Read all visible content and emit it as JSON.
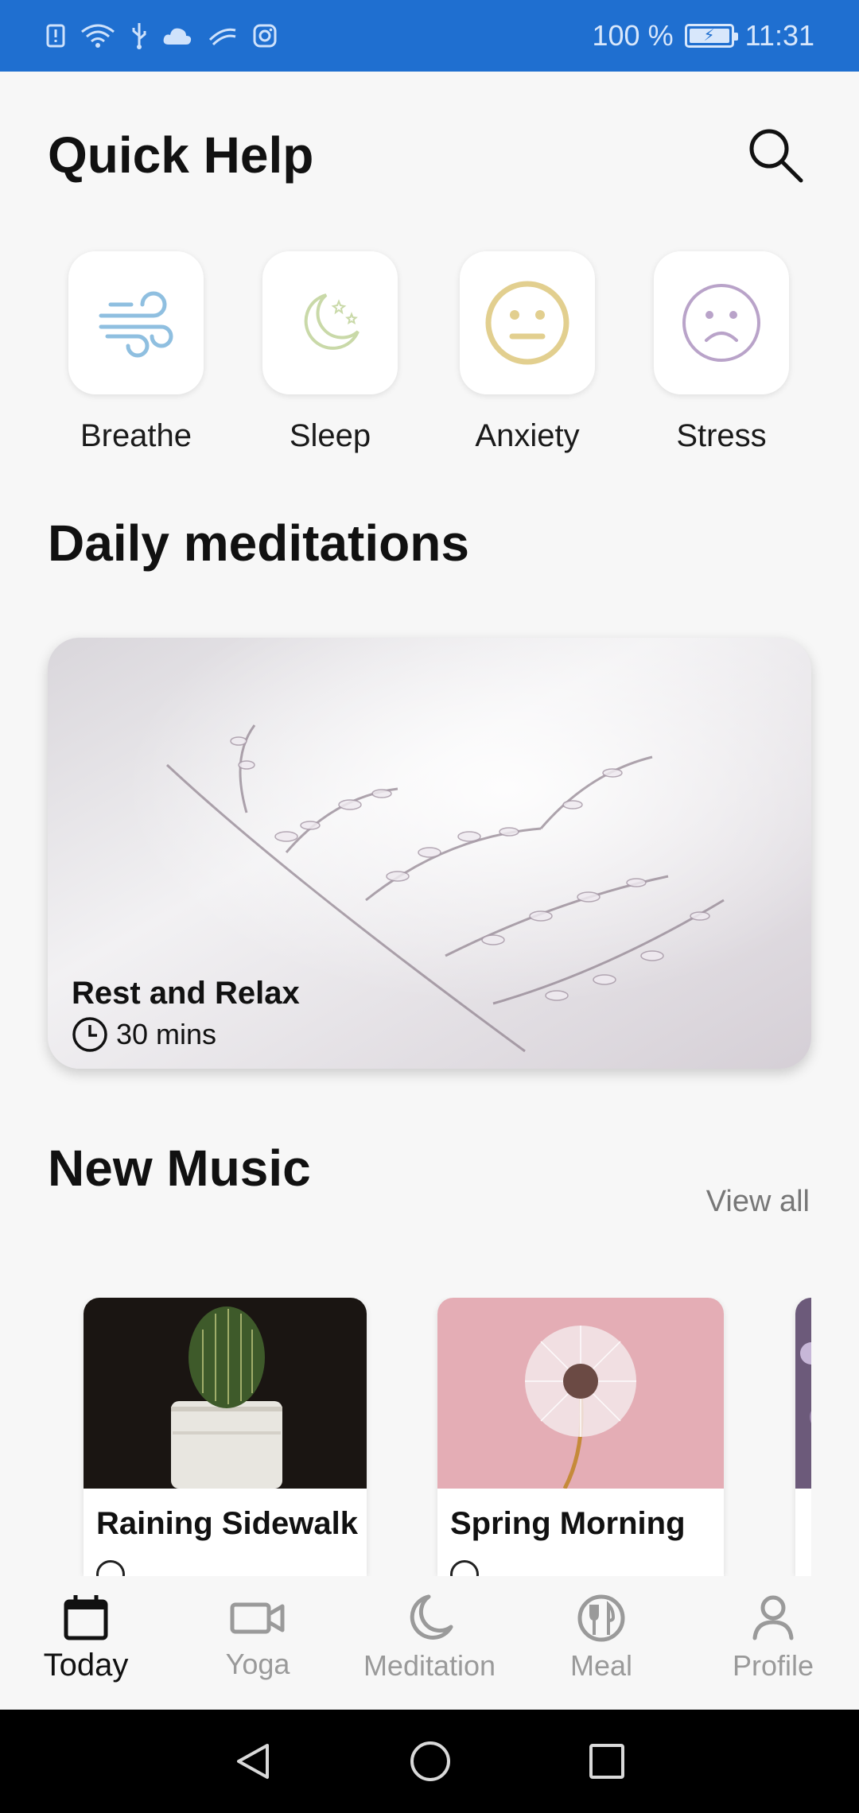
{
  "status_bar": {
    "battery_percent": "100 %",
    "time": "11:31",
    "icons": [
      "alert-icon",
      "wifi-icon",
      "usb-icon",
      "cloud-icon",
      "nfc-icon",
      "instagram-icon"
    ]
  },
  "header": {
    "title": "Quick Help",
    "search_icon": "search-icon"
  },
  "quick_help": [
    {
      "label": "Breathe",
      "icon": "wind-icon",
      "color": "#8fbfe0"
    },
    {
      "label": "Sleep",
      "icon": "moon-stars-icon",
      "color": "#c9d9a8"
    },
    {
      "label": "Anxiety",
      "icon": "neutral-face-icon",
      "color": "#e2cf8f"
    },
    {
      "label": "Stress",
      "icon": "sad-face-icon",
      "color": "#b9a3c9"
    }
  ],
  "daily_meditations": {
    "title": "Daily meditations",
    "card": {
      "title": "Rest and Relax",
      "duration": "30 mins"
    }
  },
  "new_music": {
    "title": "New Music",
    "view_all": "View all",
    "items": [
      {
        "title": "Raining Sidewalk"
      },
      {
        "title": "Spring Morning"
      }
    ]
  },
  "bottom_nav": {
    "items": [
      {
        "label": "Today",
        "icon": "calendar-icon",
        "active": true
      },
      {
        "label": "Yoga",
        "icon": "video-camera-icon",
        "active": false
      },
      {
        "label": "Meditation",
        "icon": "moon-icon",
        "active": false
      },
      {
        "label": "Meal",
        "icon": "fork-knife-icon",
        "active": false
      },
      {
        "label": "Profile",
        "icon": "person-icon",
        "active": false
      }
    ]
  },
  "colors": {
    "status_bar": "#1f6fd0",
    "background": "#f7f7f7",
    "active_nav": "#111111",
    "inactive_nav": "#9a9a9a"
  }
}
